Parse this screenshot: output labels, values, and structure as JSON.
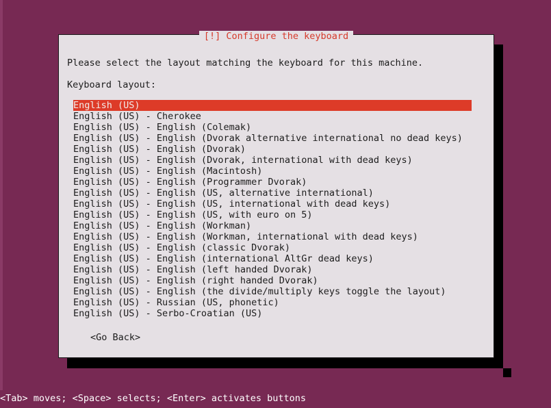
{
  "screen": {
    "background_color": "#772953",
    "accent_red": "#dd3b28",
    "dialog_background": "#e5e0e4",
    "text_color": "#1c1c1c"
  },
  "dialog": {
    "title": "[!] Configure the keyboard",
    "intro_text": "Please select the layout matching the keyboard for this machine.",
    "field_label": "Keyboard layout:",
    "go_back_label": "<Go Back>",
    "selected_index": 0,
    "options": [
      "English (US)",
      "English (US) - Cherokee",
      "English (US) - English (Colemak)",
      "English (US) - English (Dvorak alternative international no dead keys)",
      "English (US) - English (Dvorak)",
      "English (US) - English (Dvorak, international with dead keys)",
      "English (US) - English (Macintosh)",
      "English (US) - English (Programmer Dvorak)",
      "English (US) - English (US, alternative international)",
      "English (US) - English (US, international with dead keys)",
      "English (US) - English (US, with euro on 5)",
      "English (US) - English (Workman)",
      "English (US) - English (Workman, international with dead keys)",
      "English (US) - English (classic Dvorak)",
      "English (US) - English (international AltGr dead keys)",
      "English (US) - English (left handed Dvorak)",
      "English (US) - English (right handed Dvorak)",
      "English (US) - English (the divide/multiply keys toggle the layout)",
      "English (US) - Russian (US, phonetic)",
      "English (US) - Serbo-Croatian (US)"
    ]
  },
  "statusbar": {
    "help_text": "<Tab> moves; <Space> selects; <Enter> activates buttons"
  }
}
